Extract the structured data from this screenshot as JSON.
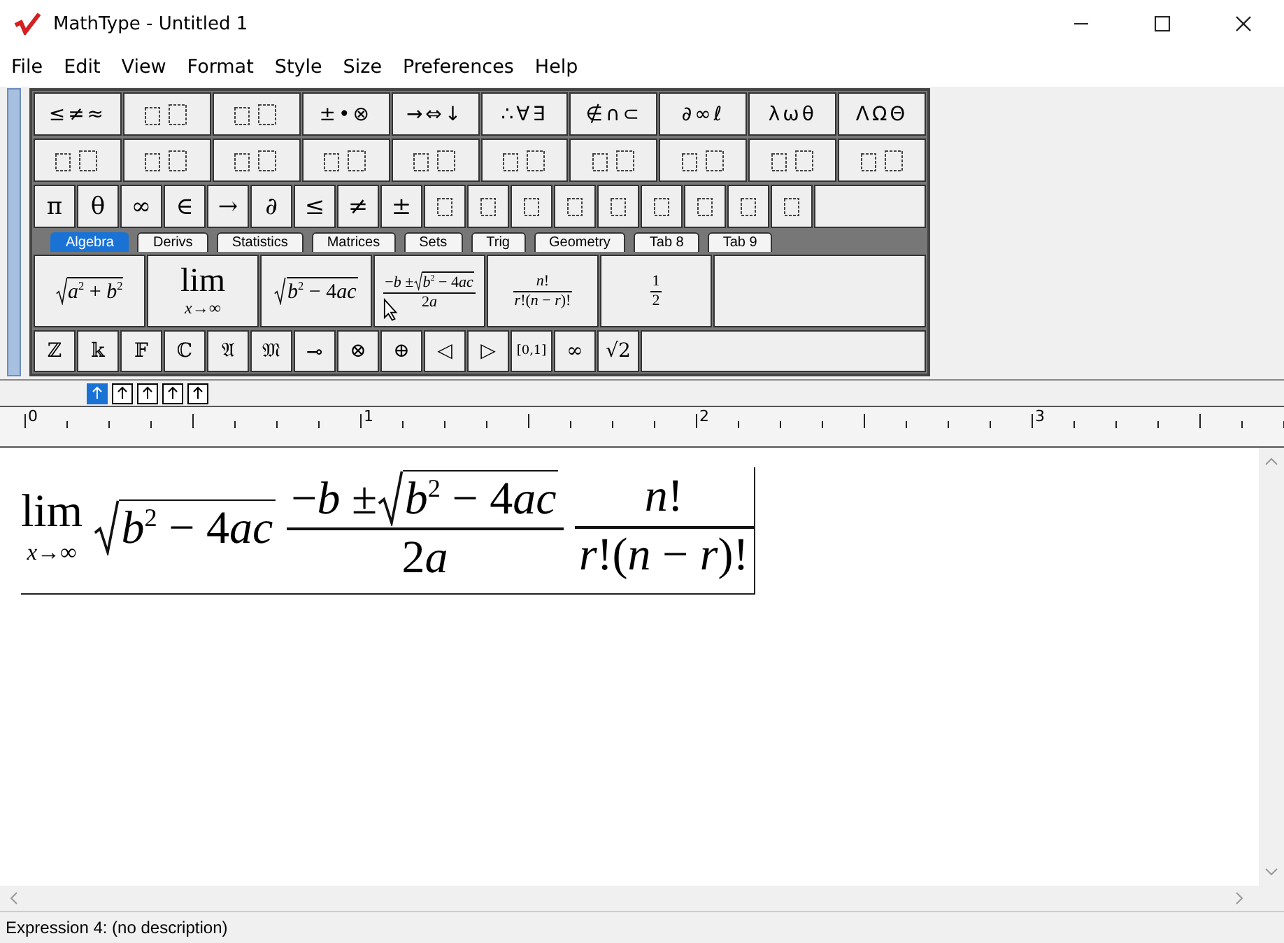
{
  "window": {
    "title": "MathType - Untitled 1"
  },
  "menu": [
    "File",
    "Edit",
    "View",
    "Format",
    "Style",
    "Size",
    "Preferences",
    "Help"
  ],
  "palette_row_1": [
    {
      "kind": "symbols",
      "label": "≤≠≈"
    },
    {
      "kind": "template"
    },
    {
      "kind": "template"
    },
    {
      "kind": "symbols",
      "label": "±•⊗"
    },
    {
      "kind": "symbols",
      "label": "→⇔↓"
    },
    {
      "kind": "symbols",
      "label": "∴∀∃"
    },
    {
      "kind": "symbols",
      "label": "∉∩⊂"
    },
    {
      "kind": "symbols",
      "label": "∂∞ℓ"
    },
    {
      "kind": "symbols",
      "label": "λωθ"
    },
    {
      "kind": "symbols",
      "label": "ΛΩΘ"
    }
  ],
  "palette_row_2": [
    {
      "kind": "template"
    },
    {
      "kind": "template"
    },
    {
      "kind": "template"
    },
    {
      "kind": "template"
    },
    {
      "kind": "template"
    },
    {
      "kind": "template"
    },
    {
      "kind": "template"
    },
    {
      "kind": "template"
    },
    {
      "kind": "template"
    },
    {
      "kind": "template"
    }
  ],
  "symbol_bar": [
    {
      "kind": "symbols",
      "label": "π"
    },
    {
      "kind": "symbols",
      "label": "θ"
    },
    {
      "kind": "symbols",
      "label": "∞"
    },
    {
      "kind": "symbols",
      "label": "∈"
    },
    {
      "kind": "symbols",
      "label": "→"
    },
    {
      "kind": "symbols",
      "label": "∂"
    },
    {
      "kind": "symbols",
      "label": "≤"
    },
    {
      "kind": "symbols",
      "label": "≠"
    },
    {
      "kind": "symbols",
      "label": "±"
    },
    {
      "kind": "template"
    },
    {
      "kind": "template"
    },
    {
      "kind": "template"
    },
    {
      "kind": "template"
    },
    {
      "kind": "template"
    },
    {
      "kind": "template"
    },
    {
      "kind": "template"
    },
    {
      "kind": "template"
    },
    {
      "kind": "template"
    }
  ],
  "tabs": [
    {
      "label": "Algebra",
      "selected": true
    },
    {
      "label": "Derivs",
      "selected": false
    },
    {
      "label": "Statistics",
      "selected": false
    },
    {
      "label": "Matrices",
      "selected": false
    },
    {
      "label": "Sets",
      "selected": false
    },
    {
      "label": "Trig",
      "selected": false
    },
    {
      "label": "Geometry",
      "selected": false
    },
    {
      "label": "Tab 8",
      "selected": false
    },
    {
      "label": "Tab 9",
      "selected": false
    }
  ],
  "expression_bar": [
    {
      "kind": "sqrt",
      "body": [
        "*a*$^{2}$ + *b*$^{2}$"
      ]
    },
    {
      "kind": "limit",
      "label": "lim",
      "under": "*x*→∞"
    },
    {
      "kind": "sqrt",
      "body": [
        "*b*$^{2}$ − 4",
        "*ac*"
      ]
    },
    {
      "kind": "fraction",
      "numerator": [
        {
          "kind": "text",
          "text": [
            "−*b* ±"
          ]
        },
        {
          "kind": "sqrt",
          "body": [
            "*b*$^{2}$ − 4",
            "*ac*"
          ]
        }
      ],
      "denominator": [
        {
          "kind": "text",
          "text": [
            "2",
            "*a*"
          ]
        }
      ]
    },
    {
      "kind": "fraction",
      "numerator": [
        {
          "kind": "text",
          "text": [
            "*n*!"
          ]
        }
      ],
      "denominator": [
        {
          "kind": "text",
          "text": [
            "*r*!(*n* − *r*)!"
          ]
        }
      ]
    },
    {
      "kind": "fraction",
      "numerator": [
        {
          "kind": "text",
          "text": [
            "1"
          ]
        }
      ],
      "denominator": [
        {
          "kind": "text",
          "text": [
            "2"
          ]
        }
      ]
    }
  ],
  "small_bar": [
    "ℤ",
    "𝕜",
    "𝔽",
    "ℂ",
    "𝔄",
    "𝔐",
    "⊸",
    "⊗",
    "⊕",
    "◁",
    "▷",
    "[0,1]",
    "∞",
    "√2"
  ],
  "size_buttons": [
    {
      "selected": true
    },
    {
      "selected": false
    },
    {
      "selected": false
    },
    {
      "selected": false
    },
    {
      "selected": false
    }
  ],
  "ruler": {
    "labels": [
      "0",
      "1",
      "2",
      "3"
    ]
  },
  "equation": [
    {
      "kind": "limit",
      "label": "lim",
      "under": "*x*→∞"
    },
    {
      "kind": "sqrt",
      "body": [
        "*b*$^{2}$ − 4",
        "*ac*"
      ]
    },
    {
      "kind": "fraction",
      "numerator": [
        {
          "kind": "text",
          "text": [
            "−*b* ±"
          ]
        },
        {
          "kind": "sqrt",
          "body": [
            "*b*$^{2}$ − 4",
            "*ac*"
          ]
        }
      ],
      "denominator": [
        {
          "kind": "text",
          "text": [
            "2",
            "*a*"
          ]
        }
      ]
    },
    {
      "kind": "fraction",
      "numerator": [
        {
          "kind": "text",
          "text": [
            "*n*!"
          ]
        }
      ],
      "denominator": [
        {
          "kind": "text",
          "text": [
            "*r*!(*n* − *r*)!"
          ]
        }
      ]
    }
  ],
  "status_bar": "Expression 4: (no description)"
}
